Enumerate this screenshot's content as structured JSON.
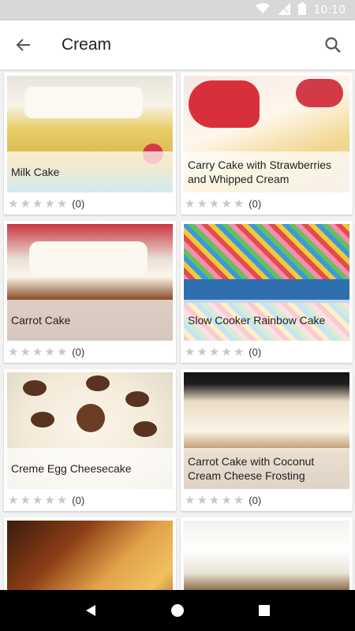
{
  "status": {
    "time": "10:10"
  },
  "header": {
    "title": "Cream"
  },
  "recipes": [
    {
      "name": "Milk Cake",
      "rating": "(0)"
    },
    {
      "name": "Carry Cake with Strawberries and Whipped Cream",
      "rating": "(0)"
    },
    {
      "name": "Carrot Cake",
      "rating": "(0)"
    },
    {
      "name": "Slow Cooker Rainbow Cake",
      "rating": "(0)"
    },
    {
      "name": "Creme Egg Cheesecake",
      "rating": "(0)"
    },
    {
      "name": "Carrot Cake with Coconut Cream Cheese Frosting",
      "rating": "(0)"
    },
    {
      "name": "",
      "rating": ""
    },
    {
      "name": "",
      "rating": ""
    }
  ],
  "colors": {
    "appbar": "#ffffff",
    "statusbar": "#d8d8d8",
    "star": "#c8c8c8",
    "navbar": "#000000"
  }
}
